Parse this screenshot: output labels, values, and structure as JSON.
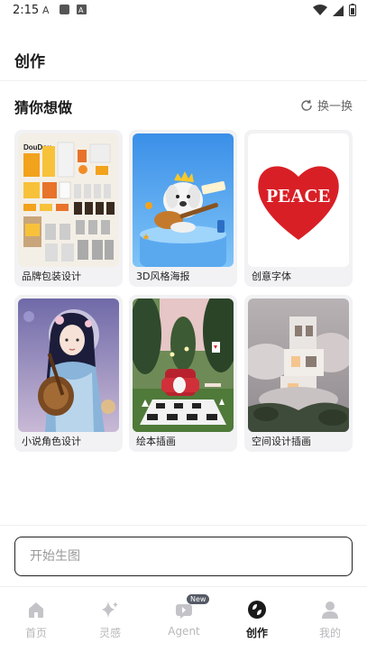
{
  "status_bar": {
    "time": "2:15"
  },
  "header": {
    "title": "创作"
  },
  "section": {
    "title": "猜你想做",
    "refresh_label": "换一换"
  },
  "cards": [
    {
      "label": "品牌包装设计",
      "art": "packaging"
    },
    {
      "label": "3D风格海报",
      "art": "poster3d"
    },
    {
      "label": "创意字体",
      "art": "peace"
    },
    {
      "label": "小说角色设计",
      "art": "character"
    },
    {
      "label": "绘本插画",
      "art": "picturebook"
    },
    {
      "label": "空间设计插画",
      "art": "space"
    }
  ],
  "peace_text": "PEACE",
  "packaging_brand": "DouDou",
  "prompt": {
    "placeholder": "开始生图"
  },
  "tabs": [
    {
      "label": "首页",
      "icon": "home-icon",
      "active": false
    },
    {
      "label": "灵感",
      "icon": "sparkle-icon",
      "active": false
    },
    {
      "label": "Agent",
      "icon": "agent-icon",
      "active": false,
      "badge": "New"
    },
    {
      "label": "创作",
      "icon": "create-icon",
      "active": true
    },
    {
      "label": "我的",
      "icon": "profile-icon",
      "active": false
    }
  ],
  "colors": {
    "accent": "#1a1a1a",
    "inactive": "#b8b8bc",
    "card_bg": "#f2f2f4",
    "peace_red": "#d91f26"
  }
}
